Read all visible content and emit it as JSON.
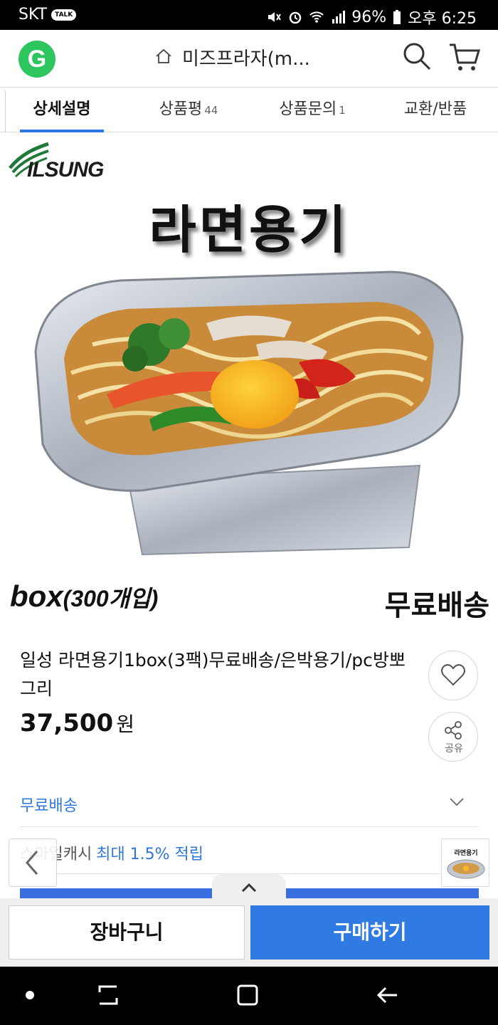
{
  "status_bar": {
    "carrier": "SKT",
    "talk_badge": "TALK",
    "battery": "96%",
    "time": "오후 6:25"
  },
  "header": {
    "logo_letter": "G",
    "shop_name": "미즈프라자(m..."
  },
  "tabs": [
    {
      "label": "상세설명",
      "count": ""
    },
    {
      "label": "상품평",
      "count": "44"
    },
    {
      "label": "상품문의",
      "count": "1"
    },
    {
      "label": "교환/반품",
      "count": ""
    }
  ],
  "product_image": {
    "brand": "ILSUNG",
    "title": "라면용기",
    "box_label": "box",
    "box_sub": "(300개입)",
    "free_shipping": "무료배송"
  },
  "product": {
    "name": "일성 라면용기1box(3팩)무료배송/은박용기/pc방뽀그리",
    "price": "37,500",
    "currency": "원",
    "share_label": "공유"
  },
  "shipping": {
    "label": "무료배송"
  },
  "smile_cash": {
    "label": "스마일캐시",
    "highlight": "최대 1.5% 적립"
  },
  "thumbnail": {
    "title": "라면용기"
  },
  "buy_bar": {
    "cart_label": "장바구니",
    "buy_label": "구매하기"
  },
  "colors": {
    "accent": "#2f77e0",
    "logo_green": "#2cc55e",
    "buy_button": "#2f7be3"
  }
}
